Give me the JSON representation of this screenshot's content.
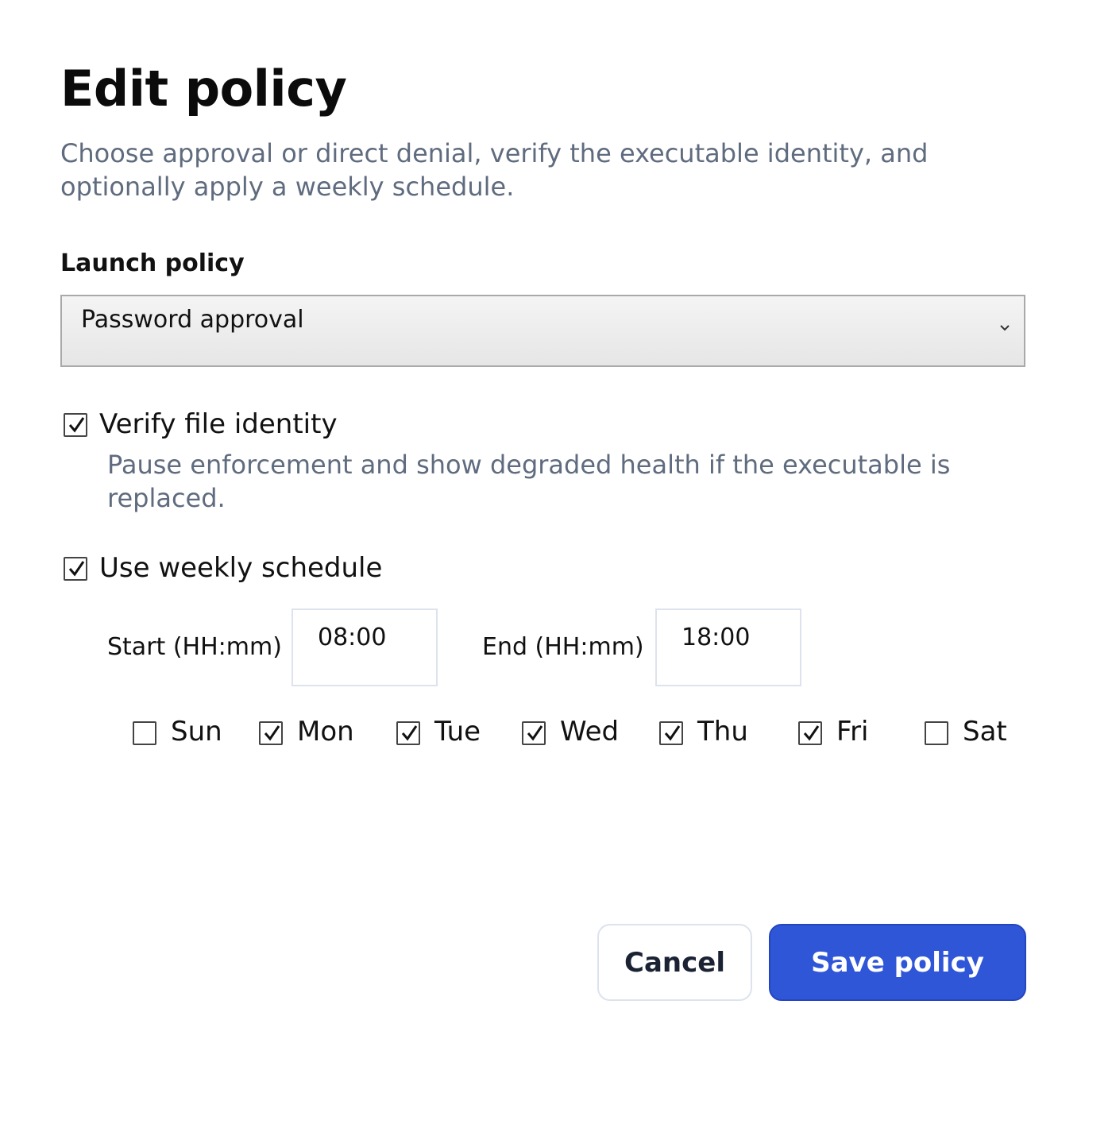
{
  "dialog": {
    "title": "Edit policy",
    "subtitle": "Choose approval or direct denial, verify the executable identity, and optionally apply a weekly schedule."
  },
  "launch_policy": {
    "label": "Launch policy",
    "selected": "Password approval"
  },
  "verify_identity": {
    "label": "Verify file identity",
    "checked": true,
    "help": "Pause enforcement and show degraded health if the executable is replaced."
  },
  "schedule": {
    "label": "Use weekly schedule",
    "checked": true,
    "start_label": "Start (HH:mm)",
    "start_value": "08:00",
    "end_label": "End (HH:mm)",
    "end_value": "18:00",
    "days": [
      {
        "label": "Sun",
        "checked": false
      },
      {
        "label": "Mon",
        "checked": true
      },
      {
        "label": "Tue",
        "checked": true
      },
      {
        "label": "Wed",
        "checked": true
      },
      {
        "label": "Thu",
        "checked": true
      },
      {
        "label": "Fri",
        "checked": true
      },
      {
        "label": "Sat",
        "checked": false
      }
    ]
  },
  "footer": {
    "cancel_label": "Cancel",
    "save_label": "Save policy"
  },
  "colors": {
    "accent": "#3056d8",
    "muted_text": "#5f6b7e"
  }
}
